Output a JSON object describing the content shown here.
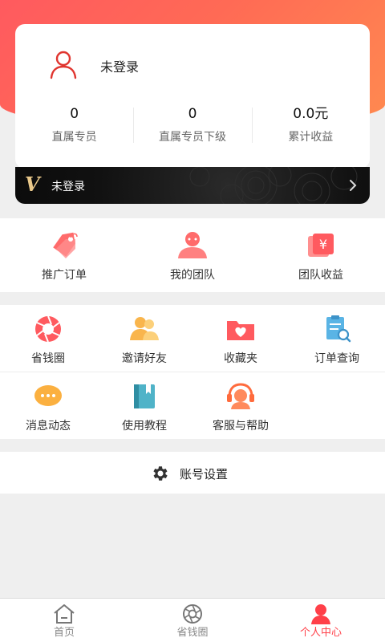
{
  "profile": {
    "username": "未登录",
    "stats": [
      {
        "value": "0",
        "label": "直属专员"
      },
      {
        "value": "0",
        "label": "直属专员下级"
      },
      {
        "value": "0.0元",
        "label": "累计收益"
      }
    ]
  },
  "vip": {
    "badge": "V",
    "text": "未登录"
  },
  "orders_section": {
    "items": [
      {
        "label": "推广订单",
        "icon": "tag-icon"
      },
      {
        "label": "我的团队",
        "icon": "team-icon"
      },
      {
        "label": "团队收益",
        "icon": "yen-icon"
      }
    ]
  },
  "tools_section": {
    "row1": [
      {
        "label": "省钱圈",
        "icon": "aperture-icon"
      },
      {
        "label": "邀请好友",
        "icon": "invite-friends-icon"
      },
      {
        "label": "收藏夹",
        "icon": "favorites-folder-icon"
      },
      {
        "label": "订单查询",
        "icon": "order-search-icon"
      }
    ],
    "row2": [
      {
        "label": "消息动态",
        "icon": "message-icon"
      },
      {
        "label": "使用教程",
        "icon": "book-icon"
      },
      {
        "label": "客服与帮助",
        "icon": "customer-service-icon"
      }
    ]
  },
  "settings": {
    "label": "账号设置",
    "icon": "gear-icon"
  },
  "tabbar": {
    "tabs": [
      {
        "label": "首页",
        "icon": "home-icon",
        "active": false
      },
      {
        "label": "省钱圈",
        "icon": "aperture-icon",
        "active": false
      },
      {
        "label": "个人中心",
        "icon": "person-icon",
        "active": true
      }
    ]
  },
  "colors": {
    "accent": "#ff4049",
    "header_start": "#ff5a5f",
    "header_end": "#ff8a50",
    "vip_gold": "#e9c88a"
  }
}
